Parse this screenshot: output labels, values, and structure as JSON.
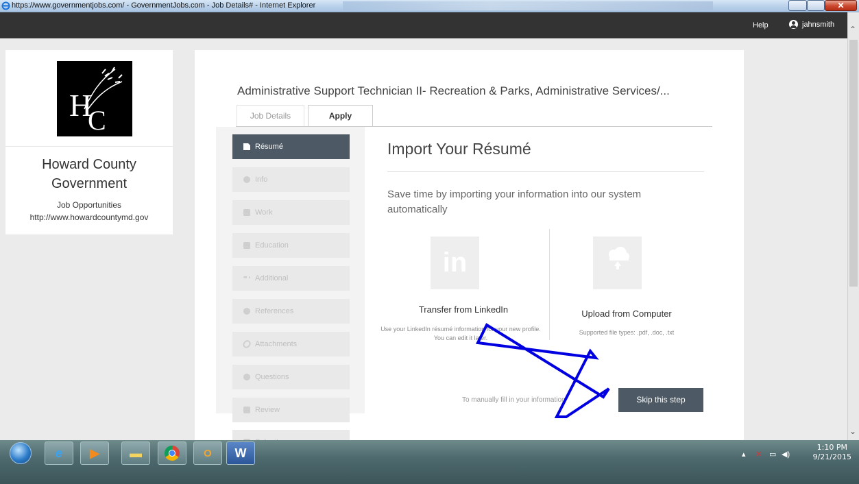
{
  "browser": {
    "title": "https://www.governmentjobs.com/ - GovernmentJobs.com - Job Details# - Internet Explorer"
  },
  "navbar": {
    "help_label": "Help",
    "username": "jahnsmith"
  },
  "org": {
    "name": "Howard County Government",
    "subtitle": "Job Opportunities",
    "url": "http://www.howardcountymd.gov"
  },
  "job": {
    "title": "Administrative Support Technician II- Recreation & Parks, Administrative Services/..."
  },
  "tabs": [
    {
      "label": "Job Details",
      "active": false
    },
    {
      "label": "Apply",
      "active": true
    }
  ],
  "steps": [
    {
      "label": "Résumé",
      "icon": "file-icon",
      "active": true
    },
    {
      "label": "Info",
      "icon": "info-icon",
      "active": false
    },
    {
      "label": "Work",
      "icon": "briefcase-icon",
      "active": false
    },
    {
      "label": "Education",
      "icon": "book-icon",
      "active": false
    },
    {
      "label": "Additional",
      "icon": "dots-icon",
      "active": false
    },
    {
      "label": "References",
      "icon": "speech-bubble-icon",
      "active": false
    },
    {
      "label": "Attachments",
      "icon": "paperclip-icon",
      "active": false
    },
    {
      "label": "Questions",
      "icon": "question-icon",
      "active": false
    },
    {
      "label": "Review",
      "icon": "review-icon",
      "active": false
    },
    {
      "label": "Submit",
      "icon": "checkbox-icon",
      "active": false
    }
  ],
  "import": {
    "title": "Import Your Résumé",
    "description": "Save time by importing your information into our system automatically",
    "linkedin": {
      "title": "Transfer from LinkedIn",
      "text": "Use your LinkedIn résumé information for your new profile. You can edit it later."
    },
    "upload": {
      "title": "Upload from Computer",
      "text": "Supported file types: .pdf, .doc, .txt"
    },
    "manual_text": "To manually fill in your information",
    "skip_label": "Skip this step"
  },
  "taskbar": {
    "time": "1:10 PM",
    "date": "9/21/2015"
  },
  "colors": {
    "active_step": "#4d5964",
    "navbar": "#333333",
    "annotation_arrow": "#0000e0"
  }
}
